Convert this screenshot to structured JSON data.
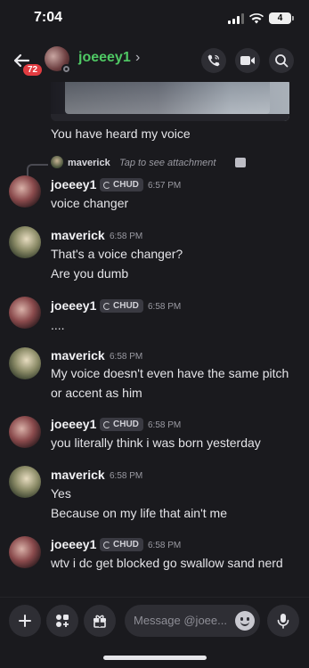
{
  "status_bar": {
    "time": "7:04",
    "battery": "4"
  },
  "header": {
    "unread_count": "72",
    "username": "joeeey1",
    "chevron": "›",
    "icons": [
      "back-arrow-icon",
      "call-icon",
      "video-icon",
      "search-icon"
    ]
  },
  "chat": {
    "pre_message": "You have heard my voice",
    "reply_preview": {
      "name": "maverick",
      "hint": "Tap to see attachment"
    },
    "messages": [
      {
        "user": "joeeey1",
        "tag": "CHUD",
        "time": "6:57 PM",
        "lines": [
          "voice changer"
        ]
      },
      {
        "user": "maverick",
        "time": "6:58 PM",
        "lines": [
          "That's a voice changer?",
          "Are you dumb"
        ]
      },
      {
        "user": "joeeey1",
        "tag": "CHUD",
        "time": "6:58 PM",
        "lines": [
          "...."
        ]
      },
      {
        "user": "maverick",
        "time": "6:58 PM",
        "lines": [
          "My voice doesn't even have the same pitch",
          "or accent as him"
        ]
      },
      {
        "user": "joeeey1",
        "tag": "CHUD",
        "time": "6:58 PM",
        "lines": [
          "you literally think i was born yesterday"
        ]
      },
      {
        "user": "maverick",
        "time": "6:58 PM",
        "lines": [
          "Yes",
          "Because on my life that ain't me"
        ]
      },
      {
        "user": "joeeey1",
        "tag": "CHUD",
        "time": "6:58 PM",
        "lines": [
          "wtv i dc get blocked go swallow sand nerd"
        ]
      }
    ]
  },
  "composer": {
    "placeholder": "Message @joee..."
  },
  "colors": {
    "background": "#1a1a1e",
    "username_green": "#4fc864",
    "badge_red": "#e23c41"
  }
}
